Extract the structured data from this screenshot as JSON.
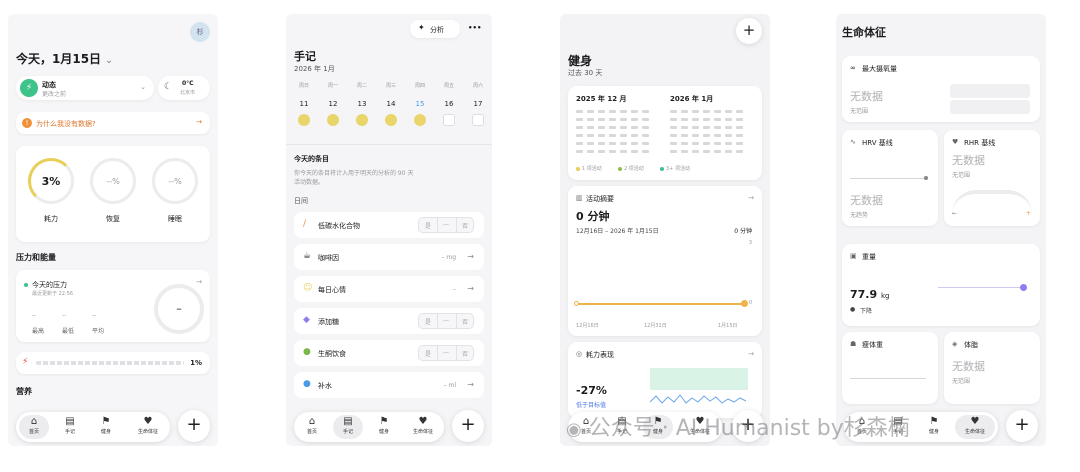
{
  "colors": {
    "accent_green": "#3ec48a",
    "accent_orange": "#f0913a",
    "accent_purple": "#8b7ff0",
    "ring_yellow": "#e8cf5a"
  },
  "tabbar": {
    "home": "首页",
    "journal": "手记",
    "fitness": "健身",
    "vitals": "生命体征",
    "plus": "+"
  },
  "screen1": {
    "avatar": "杉",
    "title": "今天，1月15日",
    "chevron": "⌄",
    "activity_label": "动态",
    "activity_sub": "更改之前",
    "weather_temp": "0°C",
    "weather_city": "北京市",
    "alert": "为什么我没有数据?",
    "ring_strain_value": "3%",
    "ring_recovery_value": "--%",
    "ring_sleep_value": "--%",
    "ring_strain_label": "耗力",
    "ring_recovery_label": "恢复",
    "ring_sleep_label": "睡眠",
    "stress_section": "压力和能量",
    "stress_title": "今天的压力",
    "stress_sub": "最近更新于 22:56",
    "stress_value": "–",
    "stat_high_label": "最高",
    "stat_low_label": "最低",
    "stat_avg_label": "平均",
    "stat_placeholder": "--",
    "energy_value": "1%",
    "nutrition_section": "营养"
  },
  "screen2": {
    "analyze_label": "分析",
    "more": "•••",
    "title": "手记",
    "month": "2026 年 1月",
    "weekdays": [
      "周日",
      "周一",
      "周二",
      "周三",
      "周四",
      "周五",
      "周六"
    ],
    "dates": [
      "11",
      "12",
      "13",
      "14",
      "15",
      "16",
      "17"
    ],
    "today_title": "今天的条目",
    "today_desc_1": "你今天的条目将计入用于明天的分析的 90 天",
    "today_desc_2": "活动数据。",
    "daytime": "日间",
    "item_carbs": "低碳水化合物",
    "item_caffeine": "咖啡因",
    "item_caffeine_value": "– mg",
    "item_mood": "每日心情",
    "item_mood_value": "–",
    "item_sugar": "添加糖",
    "item_keto": "生酮饮食",
    "item_water": "补水",
    "item_water_value": "– ml",
    "seg_yes": "是",
    "seg_mid": "—",
    "seg_no": "否"
  },
  "screen3": {
    "plus": "+",
    "title": "健身",
    "subtitle": "过去 30 天",
    "month_a": "2025 年 12 月",
    "month_b": "2026 年 1月",
    "legend_1": "1 项活动",
    "legend_2": "2 项活动",
    "legend_3": "3+ 项活动",
    "summary_title": "活动摘要",
    "summary_value": "0 分钟",
    "summary_range": "12月16日 – 2026 年 1月15日",
    "summary_right": "0 分钟",
    "axis_top": "3",
    "axis_zero": "0",
    "axis_d1": "12月16日",
    "axis_d2": "12月31日",
    "axis_d3": "1月15日",
    "strain_title": "耗力表现",
    "strain_value": "-27%",
    "strain_sub": "低于目标值"
  },
  "screen4": {
    "title": "生命体征",
    "vo2_title": "最大摄氧量",
    "no_data": "无数据",
    "no_range": "无范围",
    "hrv_title": "HRV 基线",
    "rhr_title": "RHR 基线",
    "no_trend": "无趋势",
    "weight_title": "重量",
    "weight_value": "77.9",
    "weight_unit": "kg",
    "weight_trend": "下降",
    "lean_title": "瘦体重",
    "fat_title": "体脂"
  },
  "watermark": {
    "prefix": "公众号 · ",
    "text": "AI Humanist by杉森楠"
  }
}
